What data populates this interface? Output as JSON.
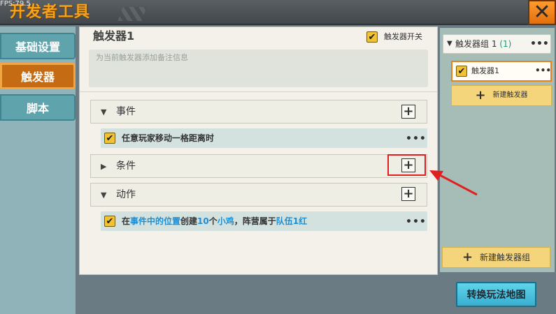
{
  "fps": "FPS:79.5",
  "app_title": "开发者工具",
  "close_label": "✕",
  "sidebar": {
    "items": [
      {
        "label": "基础设置",
        "active": false
      },
      {
        "label": "触发器",
        "active": true
      },
      {
        "label": "脚本",
        "active": false
      }
    ]
  },
  "trigger": {
    "name": "触发器1",
    "switch_label": "触发器开关",
    "switch_checked": true,
    "note_placeholder": "为当前触发器添加备注信息"
  },
  "sections": {
    "events": {
      "label": "事件",
      "expanded": true,
      "item": "任意玩家移动一格距离时"
    },
    "conditions": {
      "label": "条件",
      "expanded": false
    },
    "actions": {
      "label": "动作",
      "expanded": true,
      "item_parts": [
        "在",
        "事件中的位置",
        "创建",
        "10",
        "个",
        "小鸡",
        "，阵营属于",
        "队伍1红"
      ]
    }
  },
  "right_panel": {
    "group_label": "触发器组 1",
    "group_count": "(1)",
    "trigger_item": "触发器1",
    "new_trigger": "新建触发器",
    "new_group": "新建触发器组"
  },
  "more_label": "•••",
  "plus_label": "+",
  "check_label": "✔",
  "map_button": "转换玩法地图",
  "colors": {
    "accent_orange": "#e18420",
    "highlight_blue": "#1b8fd6",
    "annotation_red": "#e02020"
  }
}
